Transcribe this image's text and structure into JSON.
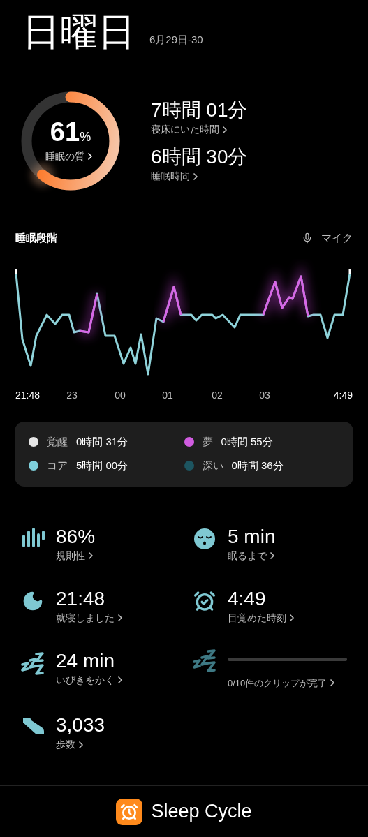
{
  "header": {
    "title": "日曜日",
    "date": "6月29日-30"
  },
  "quality": {
    "value": "61",
    "unit": "%",
    "label": "睡眠の質",
    "level": 0.61
  },
  "durations": [
    {
      "value": "7時間 01分",
      "label": "寝床にいた時間"
    },
    {
      "value": "6時間 30分",
      "label": "睡眠時間"
    }
  ],
  "sleep_stages": {
    "title": "睡眠段階",
    "mic_label": "マイク",
    "time_labels": [
      "21:48",
      "23",
      "00",
      "01",
      "02",
      "03",
      "4:49"
    ]
  },
  "legend": [
    {
      "name": "覚醒",
      "duration": "0時間 31分",
      "color": "#e6e6e6"
    },
    {
      "name": "夢",
      "duration": "0時間 55分",
      "color": "#d05ce0"
    },
    {
      "name": "コア",
      "duration": "5時間 00分",
      "color": "#7fd0dc"
    },
    {
      "name": "深い",
      "duration": "0時間 36分",
      "color": "#1d5560"
    }
  ],
  "stats": [
    {
      "kind": "regularity",
      "value": "86%",
      "label": "規則性"
    },
    {
      "kind": "fall_asleep",
      "value": "5 min",
      "label": "眠るまで"
    },
    {
      "kind": "bedtime",
      "value": "21:48",
      "label": "就寝しました"
    },
    {
      "kind": "wakeup",
      "value": "4:49",
      "label": "目覚めた時刻"
    },
    {
      "kind": "snoring",
      "value": "24 min",
      "label": "いびきをかく"
    },
    {
      "kind": "clips",
      "level": 0,
      "label": "0/10件のクリップが完了"
    },
    {
      "kind": "steps",
      "value": "3,033",
      "label": "歩数"
    }
  ],
  "footer": {
    "brand": "Sleep Cycle"
  }
}
